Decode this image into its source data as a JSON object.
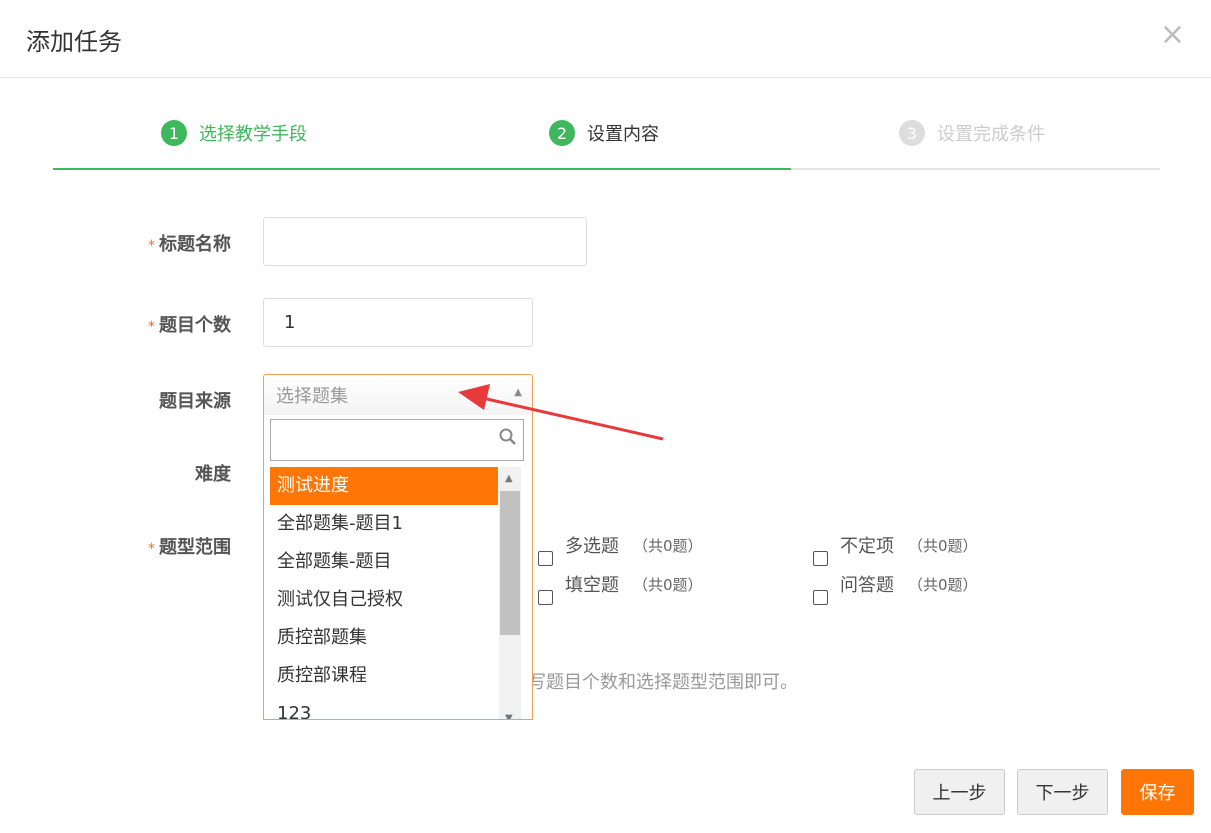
{
  "modal": {
    "title": "添加任务",
    "close": "×"
  },
  "steps": [
    {
      "num": "1",
      "label": "选择教学手段"
    },
    {
      "num": "2",
      "label": "设置内容"
    },
    {
      "num": "3",
      "label": "设置完成条件"
    }
  ],
  "form": {
    "required_mark": "*",
    "title_label": "标题名称",
    "title_value": "",
    "count_label": "题目个数",
    "count_value": "1",
    "source_label": "题目来源",
    "source_placeholder": "选择题集",
    "difficulty_label": "难度",
    "range_label": "题型范围"
  },
  "dropdown": {
    "items": [
      "测试进度",
      "全部题集-题目1",
      "全部题集-题目",
      "测试仅自己授权",
      "质控部题集",
      "质控部课程",
      "123"
    ],
    "selected_index": 0
  },
  "question_types": [
    {
      "label": "多选题",
      "count": "（共0题）"
    },
    {
      "label": "不定项",
      "count": "（共0题）"
    },
    {
      "label": "填空题",
      "count": "（共0题）"
    },
    {
      "label": "问答题",
      "count": "（共0题）"
    }
  ],
  "hint": "写题目个数和选择题型范围即可。",
  "buttons": {
    "prev": "上一步",
    "next": "下一步",
    "save": "保存"
  },
  "colors": {
    "green": "#3eb85c",
    "orange": "#ff7607",
    "arrow": "#e8393b"
  }
}
